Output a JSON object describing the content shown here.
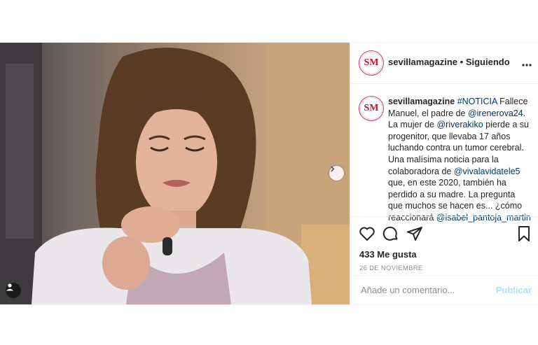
{
  "post": {
    "username": "sevillamagazine",
    "separator": "•",
    "follow_status": "Siguiendo",
    "more_icon": "more-horizontal-icon",
    "avatar_text": "SM",
    "caption": {
      "username": "sevillamagazine",
      "hashtag": "#NOTICIA",
      "text1": " Fallece Manuel, el padre de ",
      "mention1": "@irenerova24",
      "text2": ". La mujer de ",
      "mention2": "@riverakiko",
      "text3": " pierde a su progenitor, que llevaba 17 años luchando contra un tumor cerebral. Una malísima noticia para la colaboradora de ",
      "mention3": "@vivalavidatele5",
      "text4": " que, en este 2020, también ha perdido a su madre. La pregunta que muchos se hacen es... ¿cómo reaccionará ",
      "mention4": "@isabel_pantoja_martin"
    },
    "likes": "433 Me gusta",
    "date": "26 DE NOVIEMBRE",
    "comment_placeholder": "Añade un comentario...",
    "publish_label": "Publicar"
  },
  "colors": {
    "link": "#00376b",
    "publish_disabled": "#b2dffc",
    "brand_red": "#c8102e"
  }
}
